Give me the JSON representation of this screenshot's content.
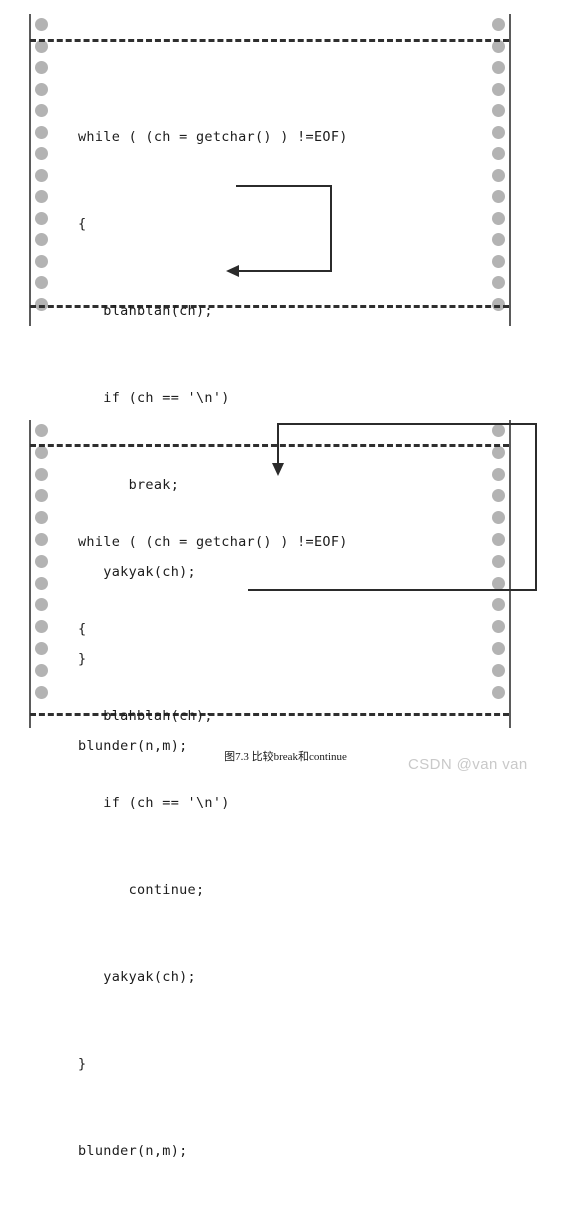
{
  "figure": {
    "caption": "图7.3 比较break和continue",
    "watermark": "CSDN @van van"
  },
  "colors": {
    "dot": "#b3b3b3",
    "rail": "#5b5b5b",
    "dashed": "#2f2f2f",
    "arrow": "#2b2b2b",
    "code_text": "#1c1c1c",
    "watermark": "#c9c9c9",
    "background": "#ffffff"
  },
  "diagrams": [
    {
      "id": "break",
      "name": "break-statement-diagram",
      "keyword": "break",
      "arrow_label": "break jumps past the end of the loop to blunder(n,m);",
      "dot_count": 14,
      "code": [
        "while ( (ch = getchar() ) !=EOF)",
        "{",
        "   blahblah(ch);",
        "   if (ch == '\\n')",
        "      break;",
        "   yakyak(ch);",
        "}",
        "blunder(n,m);"
      ]
    },
    {
      "id": "continue",
      "name": "continue-statement-diagram",
      "keyword": "continue",
      "arrow_label": "continue jumps back to the loop test while ( (ch = getchar() ) !=EOF)",
      "dot_count": 13,
      "code": [
        "while ( (ch = getchar() ) !=EOF)",
        "{",
        "   blahblah(ch);",
        "   if (ch == '\\n')",
        "      continue;",
        "   yakyak(ch);",
        "}",
        "blunder(n,m);"
      ]
    }
  ]
}
